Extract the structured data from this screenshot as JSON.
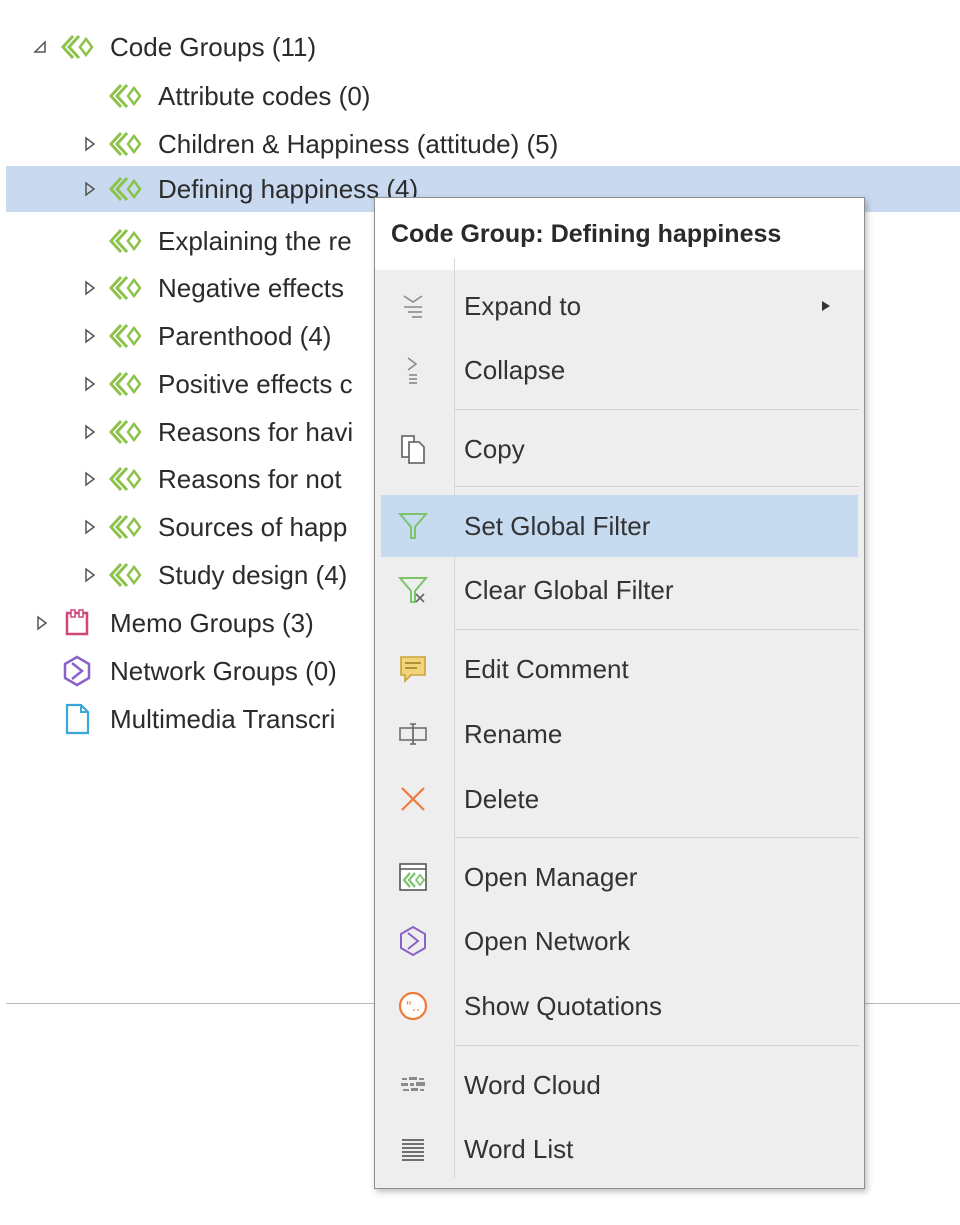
{
  "tree": {
    "root_label": "Code Groups (11)",
    "children": [
      "Attribute codes (0)",
      "Children & Happiness (attitude) (5)",
      "Defining happiness (4)",
      "Explaining the re",
      "Negative effects",
      "Parenthood (4)",
      "Positive effects c",
      "Reasons for havi",
      "Reasons for not",
      "Sources of happ",
      "Study design (4)"
    ],
    "memo_groups": "Memo Groups (3)",
    "network_groups": "Network Groups (0)",
    "multimedia": "Multimedia Transcri"
  },
  "menu": {
    "title": "Code Group: Defining happiness",
    "items": {
      "expand_to": "Expand to",
      "collapse": "Collapse",
      "copy": "Copy",
      "set_filter": "Set Global Filter",
      "clear_filter": "Clear Global Filter",
      "edit_comment": "Edit Comment",
      "rename": "Rename",
      "delete": "Delete",
      "open_manager": "Open Manager",
      "open_network": "Open Network",
      "show_quotations": "Show Quotations",
      "word_cloud": "Word Cloud",
      "word_list": "Word List"
    }
  },
  "colors": {
    "code_group_icon": "#8bc34a",
    "memo_group_icon": "#d0457a",
    "network_group_icon": "#8a62c9",
    "document_icon": "#3ba7d8",
    "selection": "#c9daf0",
    "filter_icon": "#7cc36a",
    "delete_icon": "#f07a3a",
    "quotation_icon": "#f07a3a"
  }
}
